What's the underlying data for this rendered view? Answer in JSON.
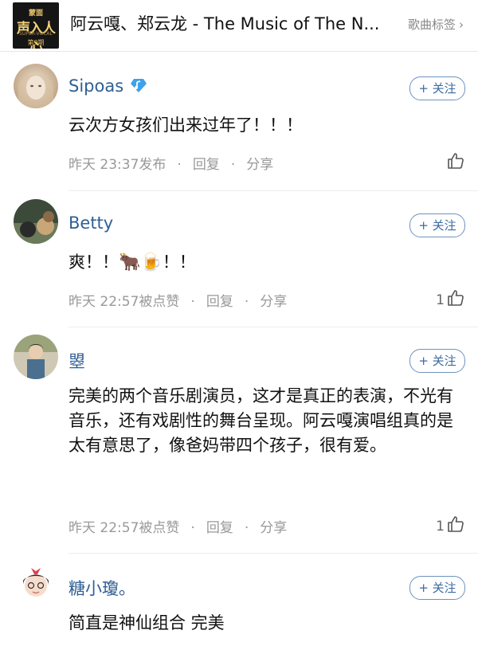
{
  "header": {
    "album": {
      "top": "蒙面",
      "main": "声入人心",
      "sub": "SUPER-VOCAL",
      "ep": "第9期"
    },
    "song_title": "阿云嘎、郑云龙 - The Music of The N...",
    "tag_link": "歌曲标签",
    "chevron": "›"
  },
  "comments": [
    {
      "username": "Sipoas",
      "has_vip": true,
      "follow": "+ 关注",
      "content": "云次方女孩们出来过年了！！！",
      "time": "昨天 23:37发布",
      "reply": "回复",
      "share": "分享",
      "likes": ""
    },
    {
      "username": "Betty",
      "follow": "+ 关注",
      "content_before": "爽！！",
      "emoji1": "🐂",
      "emoji2": "🍺",
      "content_after": "！！",
      "time": "昨天 22:57被点赞",
      "reply": "回复",
      "share": "分享",
      "likes": "1"
    },
    {
      "username": "曌",
      "follow": "+ 关注",
      "content": "完美的两个音乐剧演员，这才是真正的表演，不光有音乐，还有戏剧性的舞台呈现。阿云嘎演唱组真的是太有意思了，像爸妈带四个孩子，很有爱。",
      "time": "昨天 22:57被点赞",
      "reply": "回复",
      "share": "分享",
      "likes": "1"
    },
    {
      "username": "糖小瓊。",
      "follow": "+ 关注",
      "content": "简直是神仙组合 完美"
    }
  ],
  "separator": "·",
  "colors": {
    "username": "#2f5f94",
    "follow_border": "#6e93bd",
    "meta": "#999999"
  }
}
